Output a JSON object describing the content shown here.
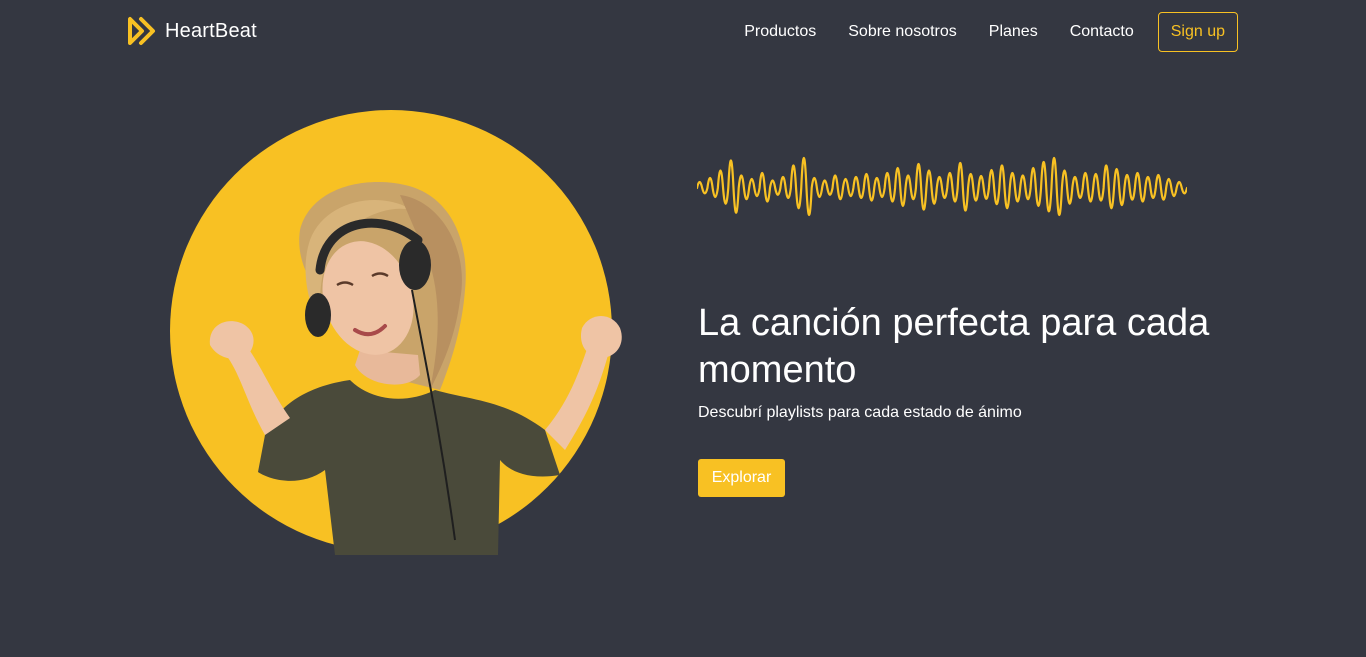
{
  "brand": {
    "name": "HeartBeat",
    "logo_icon": "double-chevron-right-icon"
  },
  "nav": {
    "items": [
      {
        "label": "Productos"
      },
      {
        "label": "Sobre nosotros"
      },
      {
        "label": "Planes"
      },
      {
        "label": "Contacto"
      }
    ],
    "signup_label": "Sign up"
  },
  "hero": {
    "title": "La canción perfecta para cada momento",
    "subtitle": "Descubrí playlists para cada estado de ánimo",
    "cta_label": "Explorar",
    "wave_icon": "sound-wave-icon",
    "image": "woman-dancing-with-headphones"
  },
  "colors": {
    "background": "#343741",
    "accent": "#f8c123",
    "text": "#ffffff"
  }
}
